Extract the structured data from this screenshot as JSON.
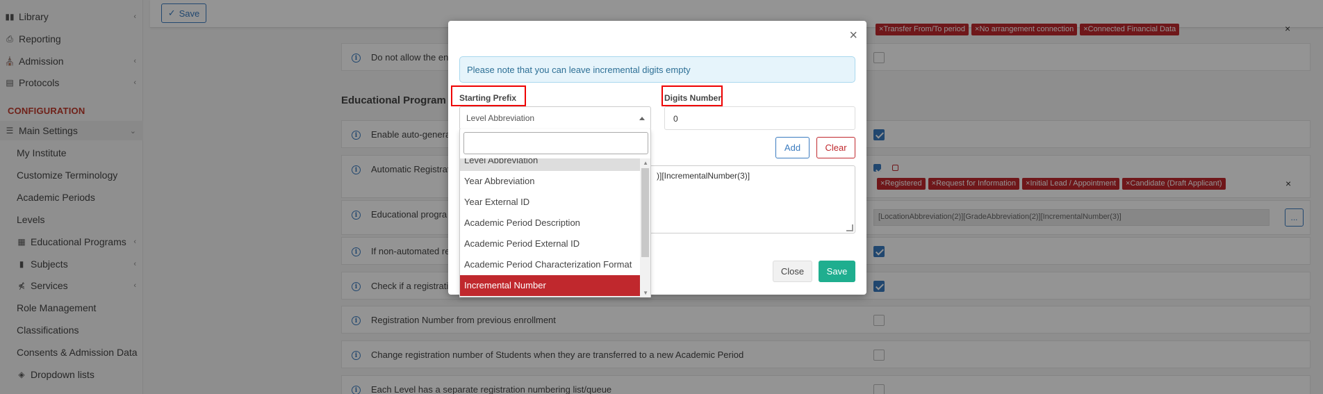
{
  "toolbar": {
    "save_label": "Save"
  },
  "sidebar": {
    "items": [
      {
        "label": "Library",
        "icon": "library-icon"
      },
      {
        "label": "Reporting",
        "icon": "printer-icon"
      },
      {
        "label": "Admission",
        "icon": "institution-icon"
      },
      {
        "label": "Protocols",
        "icon": "protocols-icon"
      }
    ],
    "section_header": "CONFIGURATION",
    "main_settings": "Main Settings",
    "sub_items": [
      "My Institute",
      "Customize Terminology",
      "Academic Periods",
      "Levels",
      "Educational Programs",
      "Subjects",
      "Services",
      "Role Management",
      "Classifications",
      "Consents & Admission Data",
      "Dropdown lists"
    ]
  },
  "main": {
    "section_title": "Educational Program R",
    "rows": [
      {
        "label": "Do not allow the en",
        "checked": false
      },
      {
        "label": "Enable auto-genera",
        "checked": true
      },
      {
        "label": "Automatic Registrat",
        "checked": false
      },
      {
        "label": "Educational progra",
        "checked": false
      },
      {
        "label": "If non-automated re",
        "checked": true
      },
      {
        "label": "Check if a registratio",
        "checked": true
      },
      {
        "label": "Registration Number from previous enrollment",
        "checked": false
      },
      {
        "label": "Change registration number of Students when they are transferred to a new Academic Period",
        "checked": false
      },
      {
        "label": "Each Level has a separate registration numbering list/queue",
        "checked": false
      }
    ],
    "top_tags": [
      "Transfer From/To period",
      "No arrangement connection",
      "Connected Financial Data"
    ],
    "status_tags": [
      "Registered",
      "Request for Information",
      "Initial Lead / Appointment",
      "Candidate (Draft Applicant)"
    ],
    "format_value": "[LocationAbbreviation(2)][GradeAbbreviation(2)][IncrementalNumber(3)]",
    "dots_label": "..."
  },
  "modal": {
    "alert": "Please note that you can leave incremental digits empty",
    "starting_prefix_label": "Starting Prefix",
    "digits_number_label": "Digits Number",
    "selected_value": "Level Abbreviation",
    "digits_value": "0",
    "add_label": "Add",
    "clear_label": "Clear",
    "textarea_value": ")][IncrementalNumber(3)]",
    "close_label": "Close",
    "save_label": "Save"
  },
  "dropdown": {
    "options": [
      "Level Abbreviation",
      "Year Abbreviation",
      "Year External ID",
      "Academic Period Description",
      "Academic Period External ID",
      "Academic Period Characterization Format",
      "Incremental Number"
    ],
    "highlighted": "Level Abbreviation",
    "selected": "Incremental Number"
  },
  "colors": {
    "accent_blue": "#3a7bbf",
    "tag_red": "#c0282d",
    "save_green": "#1fae8f",
    "annotation_red": "#ee0000"
  }
}
